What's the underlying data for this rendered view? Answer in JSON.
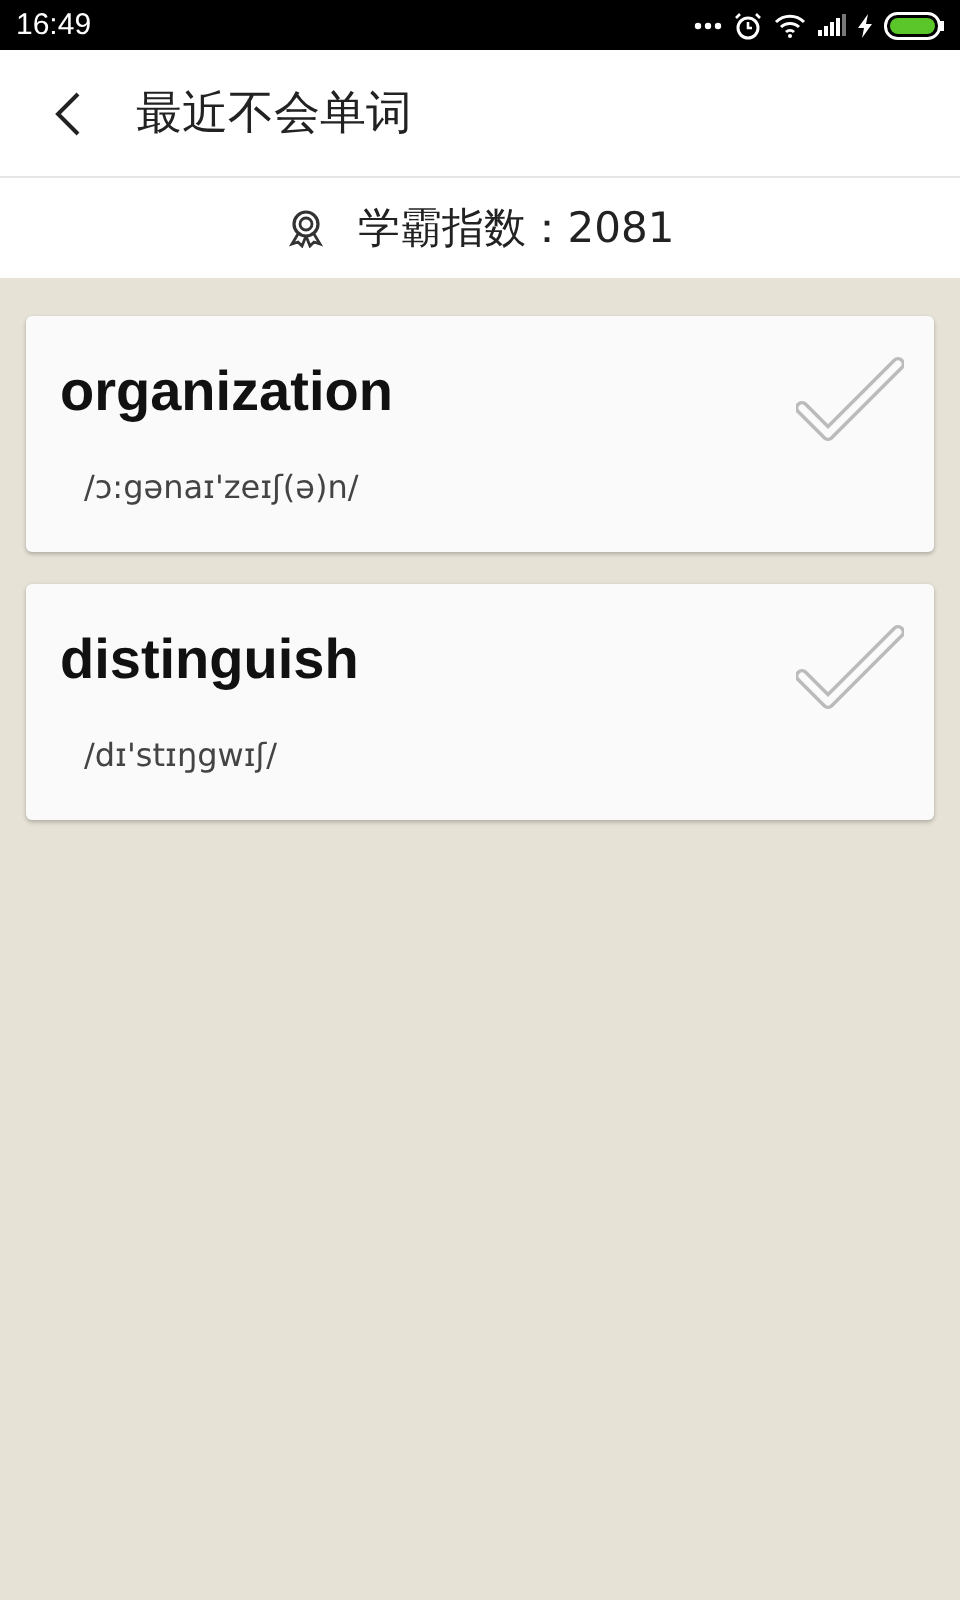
{
  "status_bar": {
    "time": "16:49"
  },
  "header": {
    "title": "最近不会单词"
  },
  "score": {
    "label": "学霸指数：2081"
  },
  "words": [
    {
      "word": "organization",
      "phonetic": "/ɔ:gənaɪ'zeɪʃ(ə)n/"
    },
    {
      "word": "distinguish",
      "phonetic": "/dɪ'stɪŋgwɪʃ/"
    }
  ]
}
